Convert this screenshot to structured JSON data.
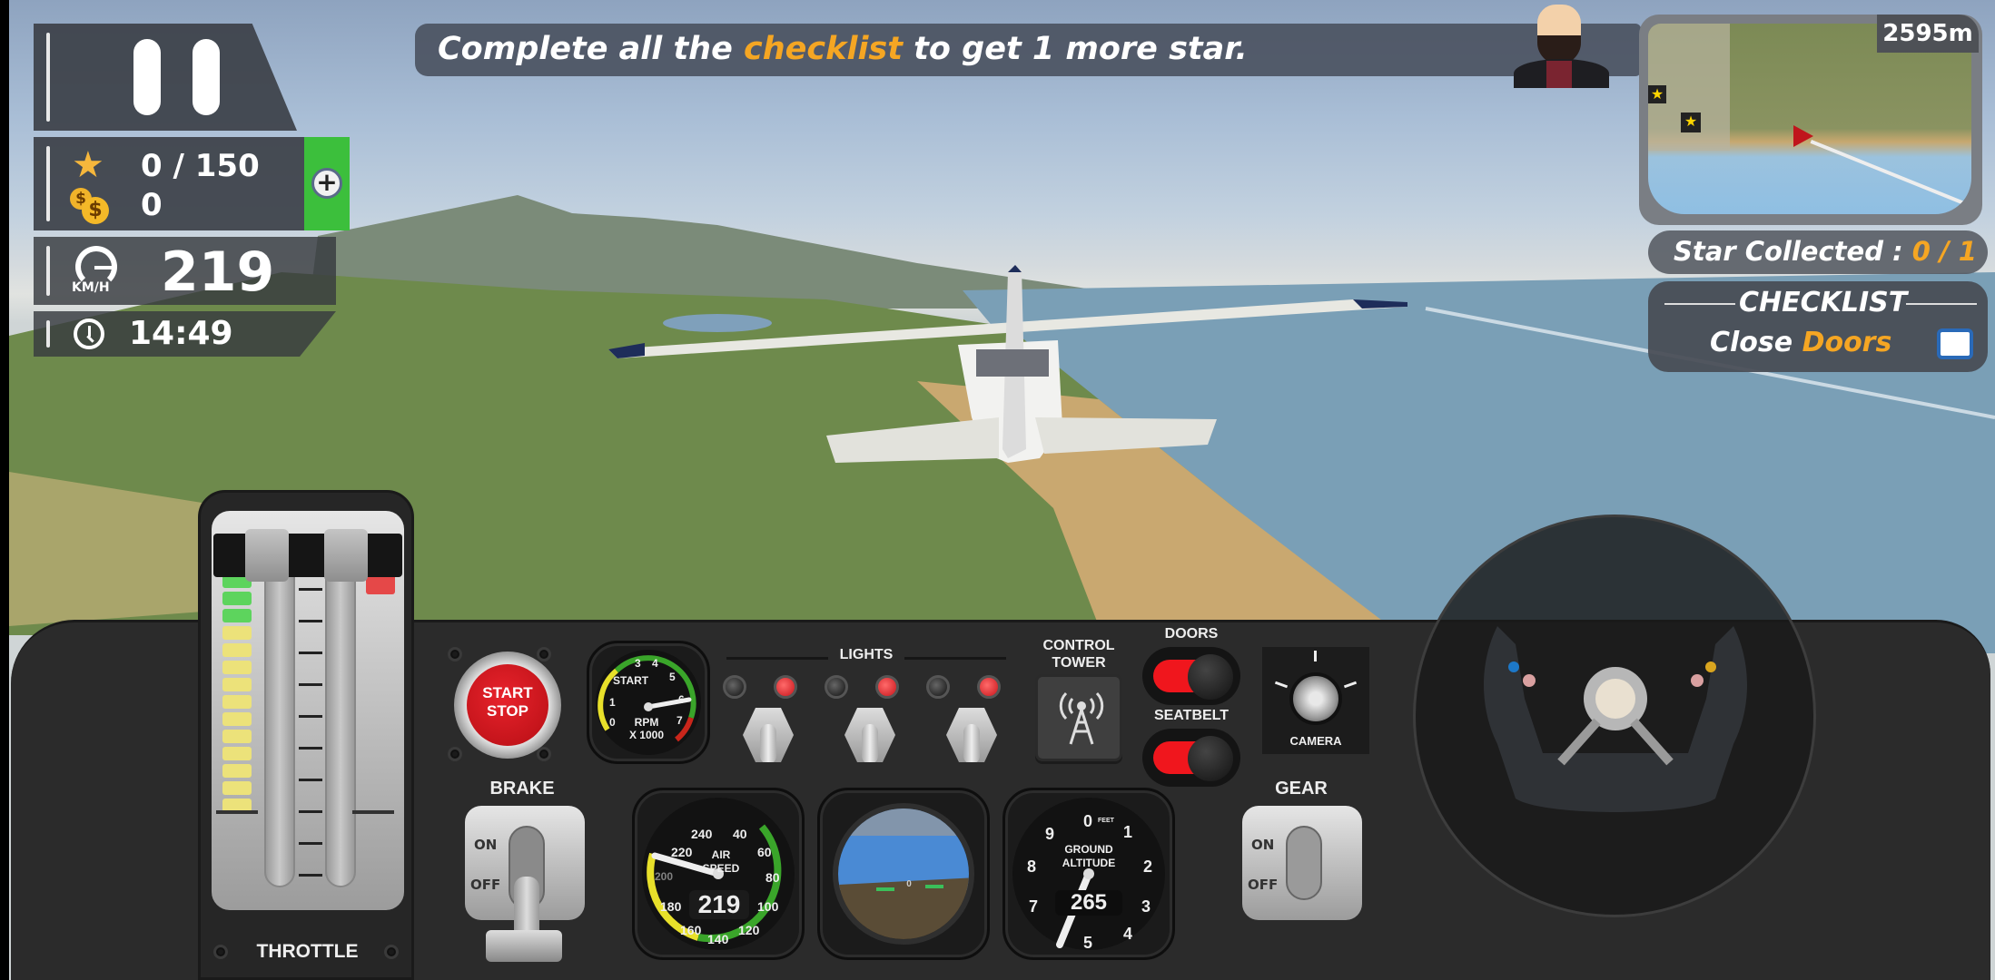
{
  "hud": {
    "stars": "0 / 150",
    "coins": "0",
    "speed": "219",
    "speed_unit": "KM/H",
    "time": "14:49",
    "icons": {
      "pause": "pause-icon",
      "star": "star-icon",
      "coin": "coin-icon",
      "add": "plus-icon",
      "speed": "speedometer-icon",
      "clock": "clock-icon"
    }
  },
  "banner": {
    "part1": "Complete all the ",
    "highlight": "checklist",
    "part2": " to get 1 more star."
  },
  "minimap": {
    "distance": "2595m"
  },
  "star_collected": {
    "label": "Star Collected : ",
    "value": "0 / 1"
  },
  "checklist": {
    "title": "CHECKLIST",
    "item_verb": "Close ",
    "item_object": "Doors",
    "item_done": false
  },
  "panel": {
    "throttle_label": "THROTTLE",
    "start_stop": [
      "START",
      "STOP"
    ],
    "rpm": {
      "start_label": "START",
      "unit_1": "RPM",
      "unit_2": "X 1000",
      "ticks": [
        "0",
        "1",
        "3",
        "4",
        "5",
        "6",
        "7"
      ],
      "value_krpm": 6
    },
    "lights_label": "LIGHTS",
    "lights": [
      {
        "on": false
      },
      {
        "on": true
      },
      {
        "on": false
      },
      {
        "on": true
      },
      {
        "on": false
      },
      {
        "on": true
      }
    ],
    "control_tower": [
      "CONTROL",
      "TOWER"
    ],
    "doors_label": "DOORS",
    "seatbelt_label": "SEATBELT",
    "camera_label": "CAMERA",
    "brake_label": "BRAKE",
    "brake_state": "OFF",
    "gear_label": "GEAR",
    "gear_state": "OFF",
    "on_label": "ON",
    "off_label": "OFF",
    "airspeed": {
      "label_1": "AIR",
      "label_2": "SPEED",
      "value": "219",
      "ticks": [
        "40",
        "60",
        "80",
        "100",
        "120",
        "140",
        "160",
        "180",
        "200",
        "220",
        "240"
      ]
    },
    "attitude": {
      "zero": "0"
    },
    "altitude": {
      "label_1": "GROUND",
      "label_2": "ALTITUDE",
      "unit": "FEET",
      "value": "265",
      "ticks": [
        "0",
        "1",
        "2",
        "3",
        "4",
        "5",
        "7",
        "8",
        "9"
      ]
    }
  },
  "colors": {
    "accent": "#f5a623",
    "hud_bg": "#3c4048",
    "add_green": "#3cbf3c",
    "led_red": "#e8141c",
    "panel": "#2a2a2a"
  }
}
